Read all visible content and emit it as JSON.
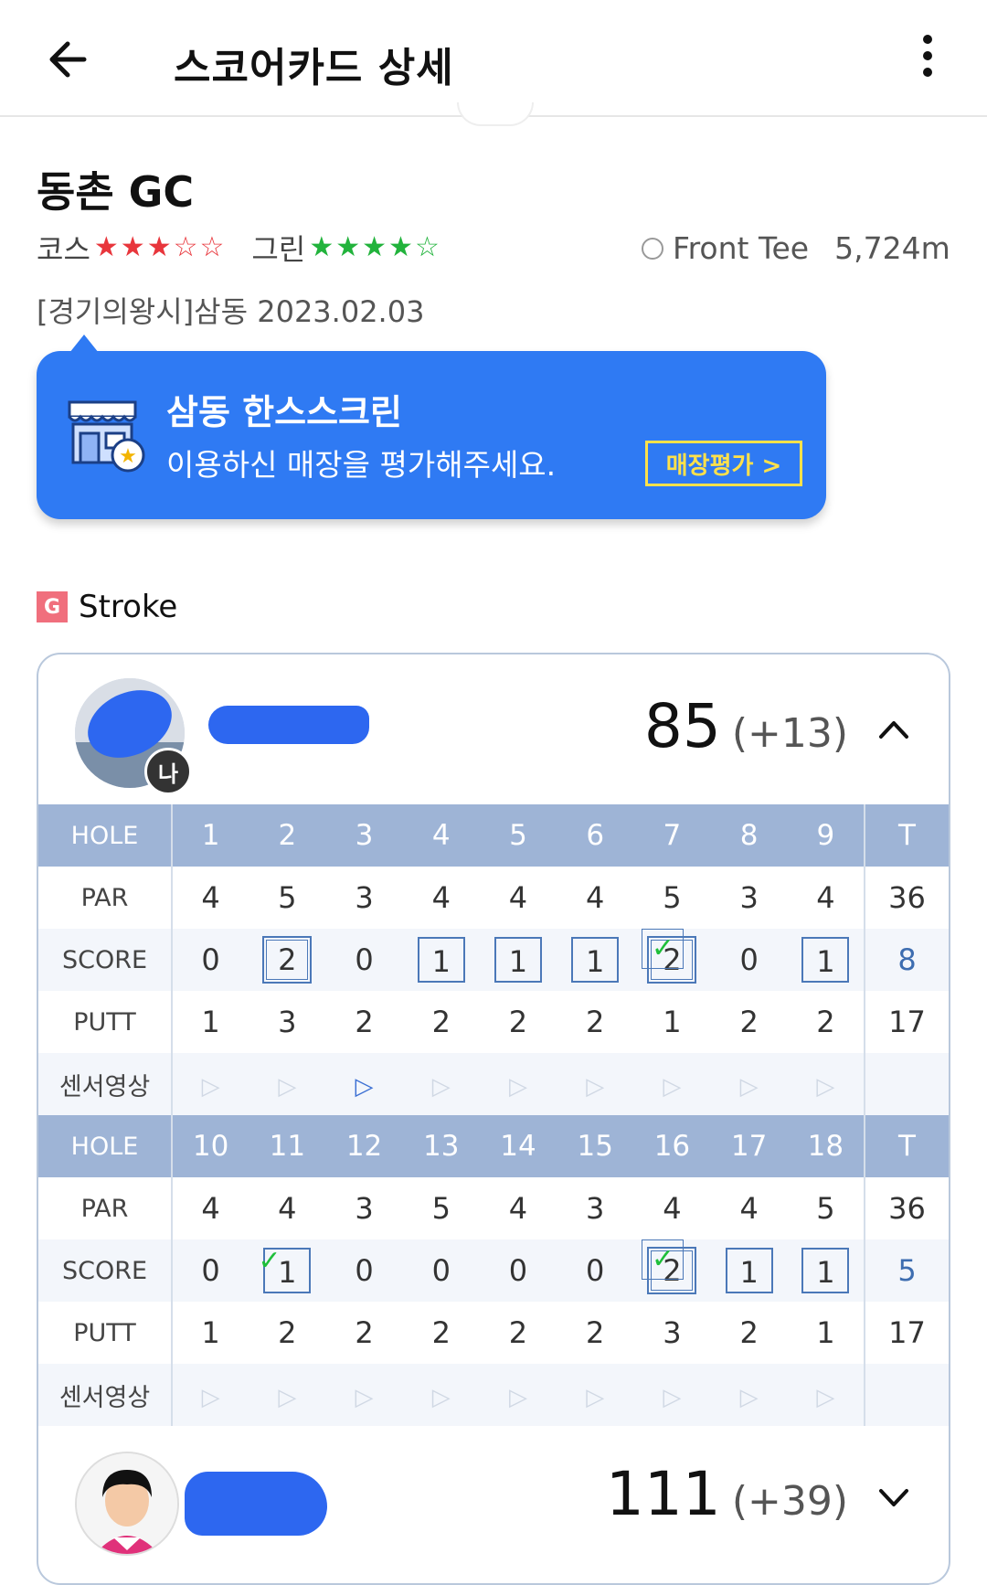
{
  "header": {
    "title": "스코어카드 상세"
  },
  "course": {
    "name": "동촌 GC",
    "course_label": "코스",
    "course_stars": 3,
    "green_label": "그린",
    "green_stars": 4,
    "tee": "Front Tee",
    "length": "5,724m",
    "place_date": "[경기의왕시]삼동 2023.02.03"
  },
  "banner": {
    "title": "삼동 한스스크린",
    "subtitle": "이용하신 매장을 평가해주세요.",
    "button": "매장평가 >"
  },
  "mode": {
    "badge": "G",
    "label": "Stroke"
  },
  "player1": {
    "badge": "나",
    "total": "85",
    "diff": "(+13)"
  },
  "front": {
    "hole_label": "HOLE",
    "par_label": "PAR",
    "score_label": "SCORE",
    "putt_label": "PUTT",
    "video_label": "센서영상",
    "holes": [
      "1",
      "2",
      "3",
      "4",
      "5",
      "6",
      "7",
      "8",
      "9"
    ],
    "t_label": "T",
    "par": [
      "4",
      "5",
      "3",
      "4",
      "4",
      "4",
      "5",
      "3",
      "4"
    ],
    "par_total": "36",
    "score": [
      "0",
      "2",
      "0",
      "1",
      "1",
      "1",
      "2",
      "0",
      "1"
    ],
    "score_total": "8",
    "putt": [
      "1",
      "3",
      "2",
      "2",
      "2",
      "2",
      "1",
      "2",
      "2"
    ],
    "putt_total": "17"
  },
  "back": {
    "hole_label": "HOLE",
    "par_label": "PAR",
    "score_label": "SCORE",
    "putt_label": "PUTT",
    "video_label": "센서영상",
    "holes": [
      "10",
      "11",
      "12",
      "13",
      "14",
      "15",
      "16",
      "17",
      "18"
    ],
    "t_label": "T",
    "par": [
      "4",
      "4",
      "3",
      "5",
      "4",
      "3",
      "4",
      "4",
      "5"
    ],
    "par_total": "36",
    "score": [
      "0",
      "1",
      "0",
      "0",
      "0",
      "0",
      "2",
      "1",
      "1"
    ],
    "score_total": "5",
    "putt": [
      "1",
      "2",
      "2",
      "2",
      "2",
      "2",
      "3",
      "2",
      "1"
    ],
    "putt_total": "17"
  },
  "player2": {
    "total": "111",
    "diff": "(+39)"
  },
  "colors": {
    "accent": "#2f7af3",
    "table_header": "#9eb4d6",
    "check": "#1fbf3a",
    "star_red": "#e8363c",
    "star_green": "#22b33c"
  }
}
